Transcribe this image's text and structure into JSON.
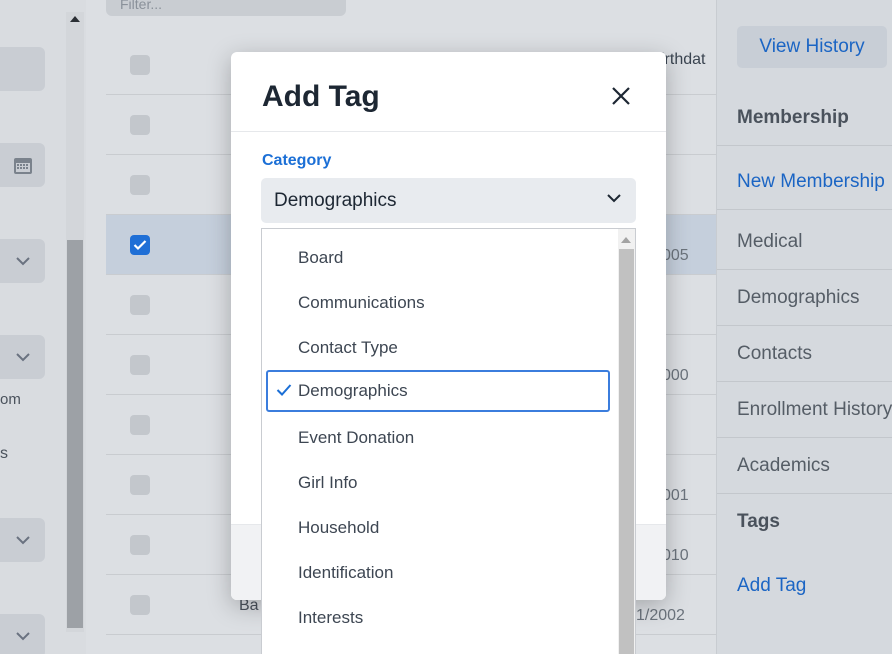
{
  "background": {
    "filter_label": "Filter...",
    "left_texts": [
      "om",
      "s"
    ],
    "table_header": "irthdat",
    "row_dates": [
      "005",
      "000",
      "001",
      "010",
      "1/2002"
    ],
    "row_name_fragment": "Ba"
  },
  "right_panel": {
    "view_history": "View History",
    "items": [
      {
        "label": "Membership",
        "style": "bold"
      },
      {
        "label": "New Membership",
        "style": "link"
      },
      {
        "label": "Medical",
        "style": "normal"
      },
      {
        "label": "Demographics",
        "style": "normal"
      },
      {
        "label": "Contacts",
        "style": "normal"
      },
      {
        "label": "Enrollment History",
        "style": "normal"
      },
      {
        "label": "Academics",
        "style": "normal"
      },
      {
        "label": "Tags",
        "style": "bold"
      },
      {
        "label": "Add Tag",
        "style": "link"
      }
    ]
  },
  "modal": {
    "title": "Add Tag",
    "category_label": "Category",
    "category_value": "Demographics"
  },
  "dropdown": {
    "options": [
      "Board",
      "Communications",
      "Contact Type",
      "Demographics",
      "Event Donation",
      "Girl Info",
      "Household",
      "Identification",
      "Interests"
    ],
    "selected": "Demographics"
  },
  "colors": {
    "accent": "#1b6fd6",
    "title": "#1d2733"
  },
  "icons": {
    "close": "close-icon",
    "chevron": "chevron-down-icon",
    "check": "checkmark-icon",
    "calendar": "calendar-icon"
  }
}
